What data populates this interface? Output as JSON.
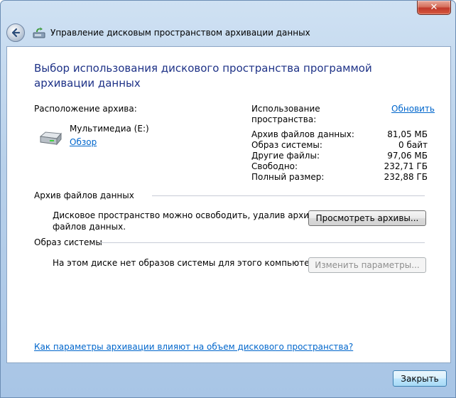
{
  "window": {
    "title": "Управление дисковым пространством архивации данных",
    "close_glyph": "✕"
  },
  "content": {
    "heading": "Выбор использования дискового пространства программой архивации данных",
    "location_label": "Расположение архива:",
    "drive_name": "Мультимедиа (E:)",
    "browse_link": "Обзор",
    "usage_label_line1": "Использование",
    "usage_label_line2": "пространства:",
    "refresh_link": "Обновить",
    "stats": [
      {
        "label": "Архив файлов данных:",
        "value": "81,05 МБ"
      },
      {
        "label": "Образ системы:",
        "value": "0 байт"
      },
      {
        "label": "Другие файлы:",
        "value": "97,06 МБ"
      },
      {
        "label": "Свободно:",
        "value": "232,71 ГБ"
      },
      {
        "label": "Полный размер:",
        "value": "232,88 ГБ"
      }
    ],
    "data_archive_section": "Архив файлов данных",
    "data_archive_text_line1": "Дисковое пространство можно освободить, удалив архивы",
    "data_archive_text_line2": "файлов данных.",
    "view_backups_button": "Просмотреть архивы...",
    "system_image_section": "Образ системы",
    "system_image_text": "На этом диске нет образов системы для этого компьютера",
    "change_settings_button": "Изменить параметры...",
    "help_link": "Как параметры архивации влияют на объем дискового пространства?"
  },
  "footer": {
    "close_button": "Закрыть"
  },
  "colors": {
    "heading": "#1e3287",
    "link": "#0066cc",
    "disabled_text": "#8e8e8e"
  },
  "icons": {
    "back": "back-arrow-icon",
    "app": "backup-app-icon",
    "drive": "hard-drive-icon",
    "close": "close-icon"
  }
}
